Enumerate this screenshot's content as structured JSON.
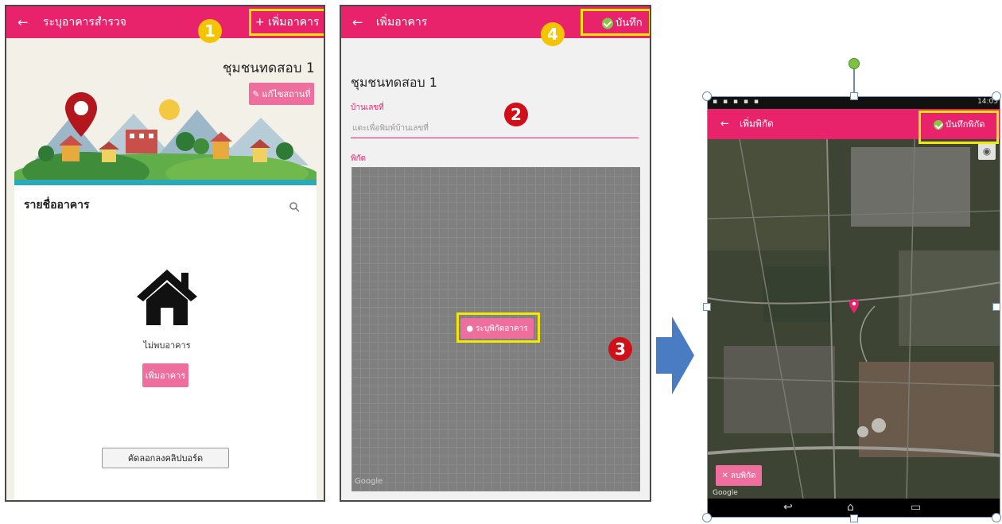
{
  "screen1": {
    "header_title": "ระบุอาคารสำรวจ",
    "add_label": "+ เพิ่มอาคาร",
    "community_name": "ชุมชนทดสอบ 1",
    "edit_location_label": "แก้ไขสถานที่",
    "building_list_title": "รายชื่ออาคาร",
    "no_buildings_text": "ไม่พบอาคาร",
    "add_building_button": "เพิ่มอาคาร",
    "copy_clipboard_button": "คัดลอกลงคลิปบอร์ด"
  },
  "screen2": {
    "header_title": "เพิ่มอาคาร",
    "save_label": "บันทึก",
    "community_name": "ชุมชนทดสอบ 1",
    "house_number_label": "บ้านเลขที่",
    "house_number_placeholder": "แตะเพื่อพิมพ์บ้านเลขที่",
    "coordinates_label": "พิกัด",
    "set_location_button": "ระบุพิกัดอาคาร",
    "map_watermark": "Google"
  },
  "screen3": {
    "status_time": "14:05",
    "header_title": "เพิ่มพิกัด",
    "save_coords_label": "บันทึกพิกัด",
    "delete_coords_button": "ลบพิกัด",
    "map_watermark": "Google"
  },
  "callouts": [
    "1",
    "2",
    "3",
    "4"
  ],
  "colors": {
    "accent": "#e8236b",
    "highlight": "#f4e800",
    "arrow": "#4a7cc4"
  }
}
